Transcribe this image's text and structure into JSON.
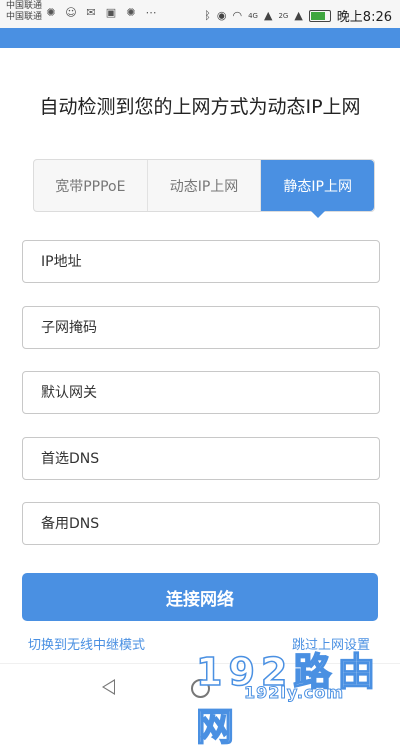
{
  "status_bar": {
    "carrier_1": "中国联通",
    "carrier_2": "中国联通",
    "network_1": "4G",
    "network_2": "2G",
    "time": "晚上8:26"
  },
  "page": {
    "title": "自动检测到您的上网方式为动态IP上网"
  },
  "tabs": [
    {
      "label": "宽带PPPoE",
      "active": false
    },
    {
      "label": "动态IP上网",
      "active": false
    },
    {
      "label": "静态IP上网",
      "active": true
    }
  ],
  "form": {
    "ip_address_placeholder": "IP地址",
    "subnet_mask_placeholder": "子网掩码",
    "gateway_placeholder": "默认网关",
    "primary_dns_placeholder": "首选DNS",
    "secondary_dns_placeholder": "备用DNS"
  },
  "actions": {
    "connect_label": "连接网络",
    "switch_repeater_link": "切换到无线中继模式",
    "skip_setup_link": "跳过上网设置"
  },
  "watermark": {
    "big": "192路由网",
    "small": "192ly.com"
  },
  "colors": {
    "accent": "#4a90e2"
  }
}
